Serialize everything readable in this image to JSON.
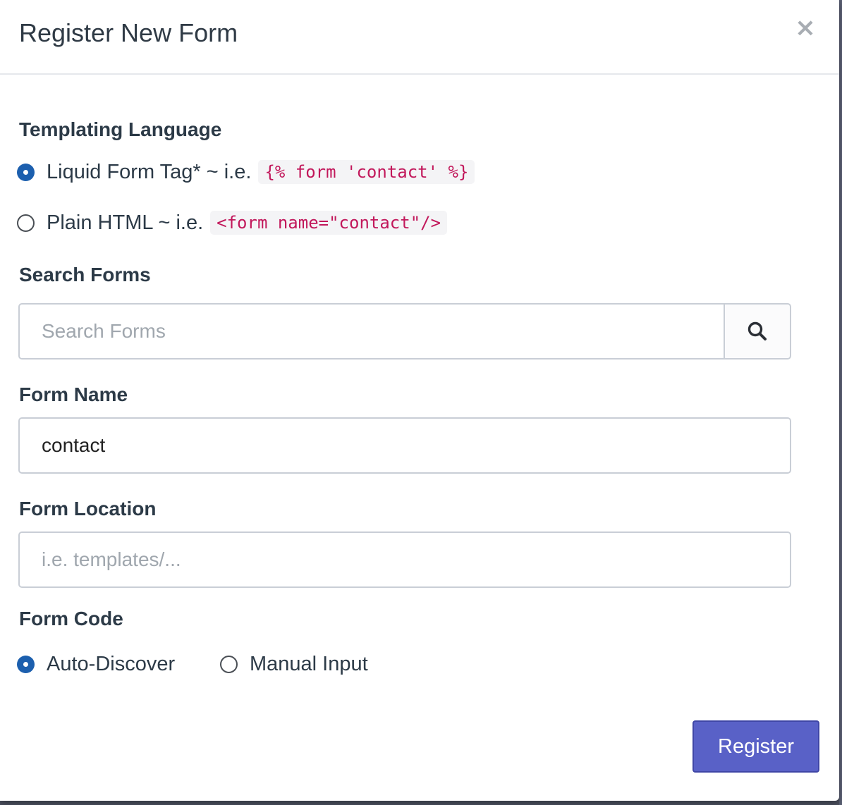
{
  "modal": {
    "title": "Register New Form",
    "close_label": "×"
  },
  "templating_language": {
    "label": "Templating Language",
    "options": [
      {
        "text": "Liquid Form Tag* ~ i.e.",
        "code": "{% form 'contact' %}",
        "checked": true
      },
      {
        "text": "Plain HTML ~ i.e.",
        "code": "<form name=\"contact\"/>",
        "checked": false
      }
    ]
  },
  "search_forms": {
    "label": "Search Forms",
    "placeholder": "Search Forms",
    "value": "",
    "button_icon": "search-icon"
  },
  "form_name": {
    "label": "Form Name",
    "value": "contact"
  },
  "form_location": {
    "label": "Form Location",
    "placeholder": "i.e. templates/...",
    "value": ""
  },
  "form_code": {
    "label": "Form Code",
    "options": [
      {
        "text": "Auto-Discover",
        "checked": true
      },
      {
        "text": "Manual Input",
        "checked": false
      }
    ]
  },
  "footer": {
    "register_label": "Register"
  },
  "colors": {
    "accent": "#5961c7",
    "radio_checked": "#1c5fae",
    "code_text": "#c2185b"
  }
}
